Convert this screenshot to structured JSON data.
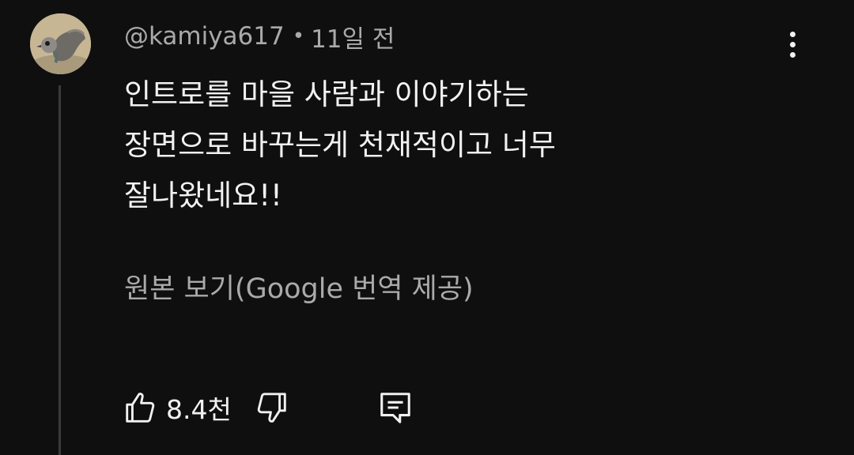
{
  "comment": {
    "author": "@kamiya617",
    "separator": "•",
    "timestamp": "11일 전",
    "text_lines": [
      "인트로를 마을 사람과 이야기하는",
      "장면으로 바꾸는게 천재적이고 너무",
      "잘나왔네요!!"
    ],
    "see_original_label": "원본 보기(Google 번역 제공)",
    "like_count": "8.4천"
  },
  "icons": {
    "more": "more-vert-icon",
    "like": "thumb-up-icon",
    "dislike": "thumb-down-icon",
    "reply": "comment-reply-icon"
  },
  "colors": {
    "background": "#0f0f0f",
    "primary_text": "#f1f1f1",
    "secondary_text": "#aaaaaa",
    "thread_line": "#3a3a3a"
  }
}
